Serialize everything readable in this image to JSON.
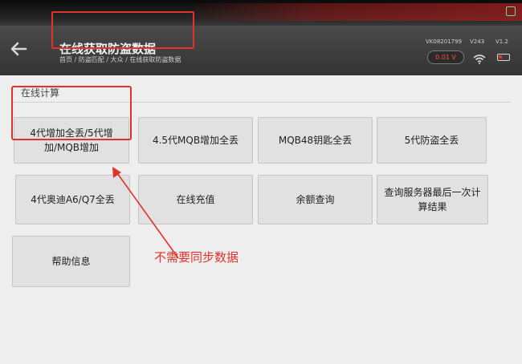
{
  "header": {
    "title": "在线获取防盗数据",
    "breadcrumb": "首页 / 防盗匹配 / 大众 / 在线获取防盗数据",
    "vin": "VK08201799",
    "version": "V243",
    "version2": "V1.2",
    "voltage": "0.01 V"
  },
  "section": {
    "title": "在线计算"
  },
  "buttons": [
    {
      "label": "4代增加全丢/5代增加/MQB增加"
    },
    {
      "label": "4.5代MQB增加全丢"
    },
    {
      "label": "MQB48钥匙全丢"
    },
    {
      "label": "5代防盗全丢"
    },
    {
      "label": "4代奥迪A6/Q7全丢"
    },
    {
      "label": "在线充值"
    },
    {
      "label": "余额查询"
    },
    {
      "label": "查询服务器最后一次计算结果"
    },
    {
      "label": "帮助信息"
    }
  ],
  "annotation": "不需要同步数据",
  "colors": {
    "highlight": "#e0332b",
    "header": "#3e3e3e",
    "screen": "#eeeeee"
  },
  "icons": [
    "back-arrow-icon",
    "wifi-icon",
    "battery-icon",
    "voltage-icon"
  ]
}
